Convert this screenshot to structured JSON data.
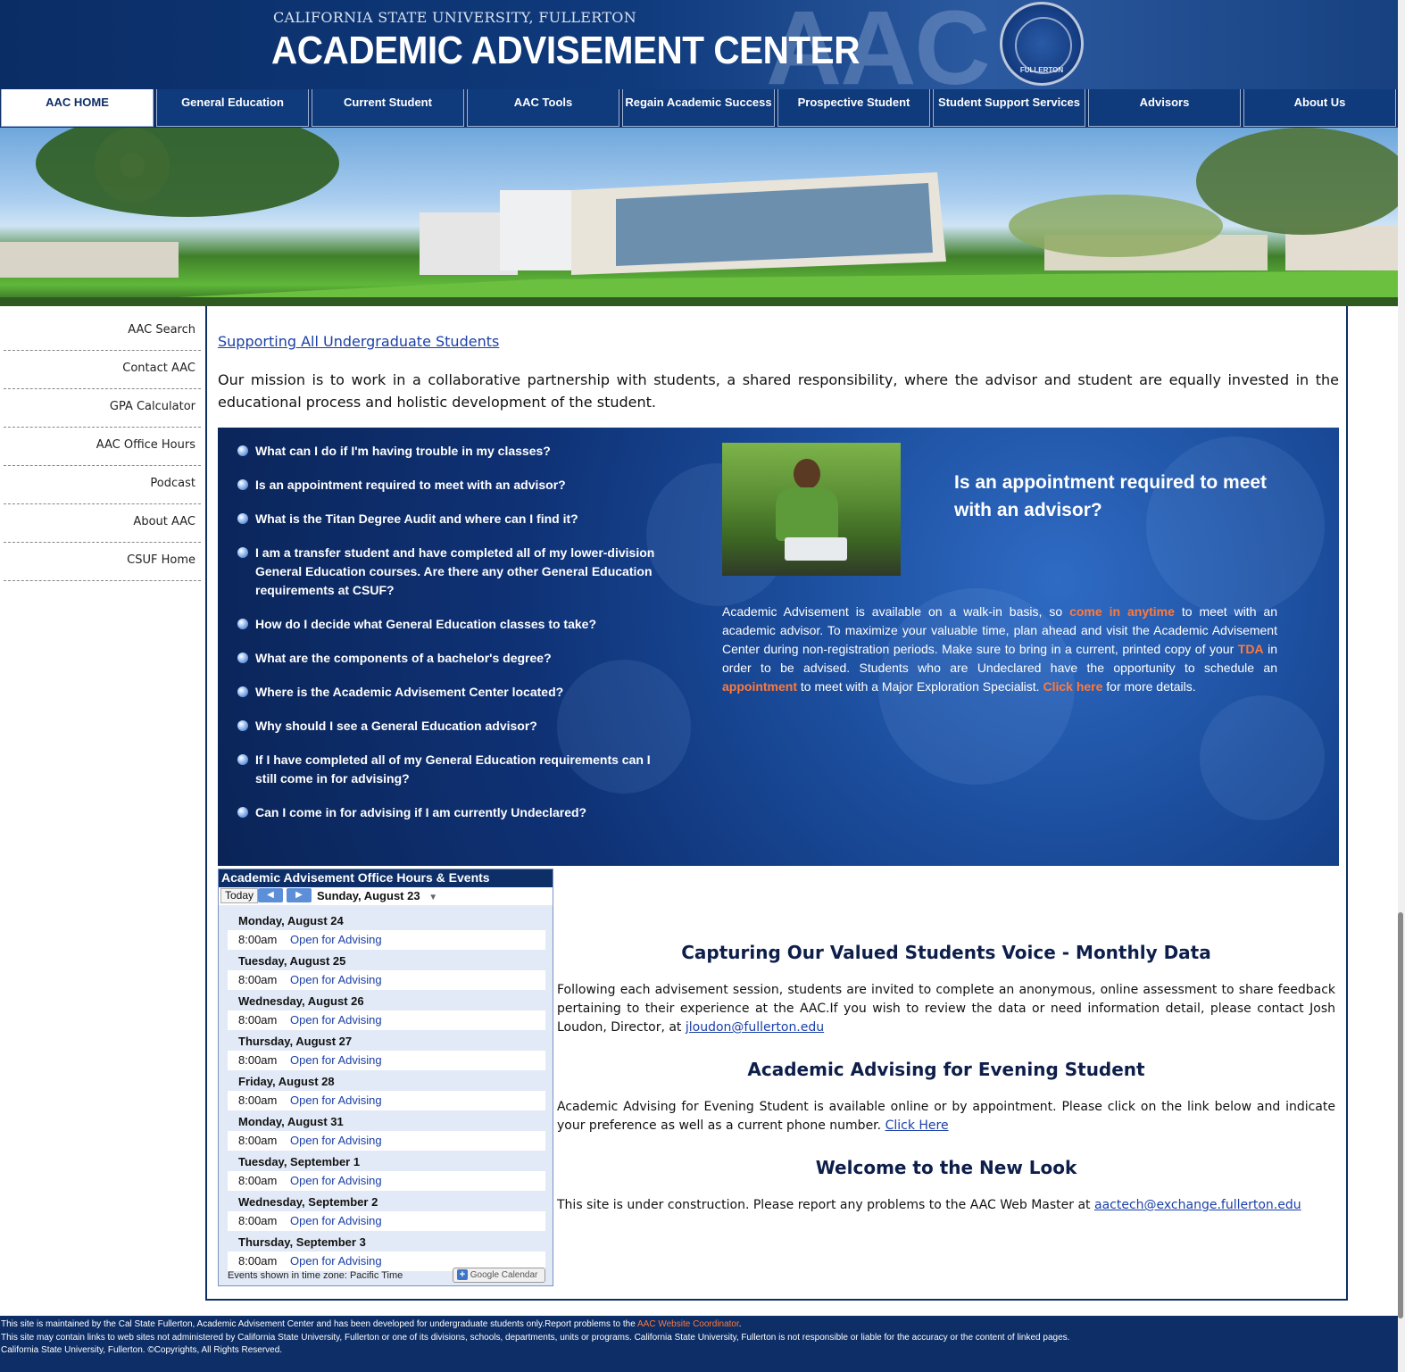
{
  "header": {
    "university": "CALIFORNIA STATE UNIVERSITY, FULLERTON",
    "title": "ACADEMIC ADVISEMENT CENTER",
    "watermark": "AAC",
    "seal_text": "FULLERTON"
  },
  "nav": {
    "items": [
      {
        "label": "AAC HOME",
        "active": true
      },
      {
        "label": "General Education"
      },
      {
        "label": "Current Student"
      },
      {
        "label": "AAC Tools"
      },
      {
        "label": "Regain Academic Success"
      },
      {
        "label": "Prospective Student"
      },
      {
        "label": "Student Support Services"
      },
      {
        "label": "Advisors"
      },
      {
        "label": "About Us"
      }
    ]
  },
  "sidebar": {
    "items": [
      {
        "label": "AAC Search"
      },
      {
        "label": "Contact AAC"
      },
      {
        "label": "GPA Calculator"
      },
      {
        "label": "AAC Office Hours"
      },
      {
        "label": "Podcast"
      },
      {
        "label": "About AAC"
      },
      {
        "label": "CSUF Home"
      }
    ]
  },
  "main": {
    "support_link": "Supporting All Undergraduate Students",
    "mission": "Our mission is to work in a collaborative partnership with students, a shared responsibility, where the advisor and student are equally invested in the educational process and holistic development of the student."
  },
  "faq": {
    "questions": [
      "What can I do if I'm having trouble in my classes?",
      "Is an appointment required to meet with an advisor?",
      "What is the Titan Degree Audit and where can I find it?",
      "I am a transfer student and have completed all of my lower-division General Education courses. Are there any other General Education requirements at CSUF?",
      "How do I decide what General Education classes to take?",
      "What are the components of a bachelor's degree?",
      "Where is the Academic Advisement Center located?",
      "Why should I see a General Education advisor?",
      "If I have completed all of my General Education requirements can I still come in for advising?",
      "Can I come in for advising if I am currently Undeclared?"
    ],
    "selected_title": "Is an appointment required to meet with an advisor?",
    "answer": {
      "part1": "Academic Advisement is available on a walk-in basis, so ",
      "link1": "come in anytime",
      "part2": " to meet with an academic advisor. To maximize your valuable time, plan ahead and visit the Academic Advisement Center during non-registration periods. Make sure to bring in a current, printed copy of your ",
      "link2": "TDA",
      "part3": " in order to be advised. Students who are Undeclared have the opportunity to schedule an ",
      "link3": "appointment",
      "part4": " to meet with a Major Exploration Specialist. ",
      "link4": "Click here",
      "part5": " for more details."
    }
  },
  "calendar": {
    "title": "Academic Advisement Office Hours & Events",
    "today_label": "Today",
    "prev_label": "◀",
    "next_label": "▶",
    "current_date": "Sunday, August 23",
    "days": [
      {
        "label": "Monday, August 24",
        "time": "8:00am",
        "event": "Open for Advising"
      },
      {
        "label": "Tuesday, August 25",
        "time": "8:00am",
        "event": "Open for Advising"
      },
      {
        "label": "Wednesday, August 26",
        "time": "8:00am",
        "event": "Open for Advising"
      },
      {
        "label": "Thursday, August 27",
        "time": "8:00am",
        "event": "Open for Advising"
      },
      {
        "label": "Friday, August 28",
        "time": "8:00am",
        "event": "Open for Advising"
      },
      {
        "label": "Monday, August 31",
        "time": "8:00am",
        "event": "Open for Advising"
      },
      {
        "label": "Tuesday, September 1",
        "time": "8:00am",
        "event": "Open for Advising"
      },
      {
        "label": "Wednesday, September 2",
        "time": "8:00am",
        "event": "Open for Advising"
      },
      {
        "label": "Thursday, September 3",
        "time": "8:00am",
        "event": "Open for Advising"
      }
    ],
    "timezone": "Events shown in time zone: Pacific Time",
    "gcal_button": "Google Calendar",
    "gcal_plus": "+"
  },
  "sections": {
    "voice_title": "Capturing Our Valued Students Voice - Monthly Data",
    "voice_body": "Following each advisement session, students are invited to complete an anonymous, online assessment to share feedback pertaining to their experience at the AAC.If you wish to review the data or need information detail, please contact Josh Loudon, Director, at ",
    "voice_email": "jloudon@fullerton.edu",
    "evening_title": "Academic Advising for Evening Student",
    "evening_body": "Academic Advising for Evening Student is available online or by appointment. Please click on the link below and indicate your preference as well as a current phone number. ",
    "evening_link": "Click Here",
    "newlook_title": "Welcome to the New Look",
    "newlook_body": "This site is under construction. Please report any problems to the AAC Web Master at ",
    "newlook_email": "aactech@exchange.fullerton.edu"
  },
  "footer": {
    "line1": "This site is maintained by the Cal State Fullerton, Academic Advisement Center and has been developed for undergraduate students only.Report problems to the ",
    "line1_link": "AAC Website Coordinator",
    "line1_end": ".",
    "line2": "This site may contain links to web sites not administered by California State University, Fullerton or one of its divisions, schools, departments, units or programs. California State University, Fullerton is not responsible or liable for the accuracy or the content of linked pages.",
    "line3": "California State University, Fullerton. ©Copyrights, All Rights Reserved."
  },
  "colors": {
    "primary_navy": "#0d2e66",
    "link_blue": "#1a3fa8",
    "highlight_orange": "#ff7a3a"
  }
}
